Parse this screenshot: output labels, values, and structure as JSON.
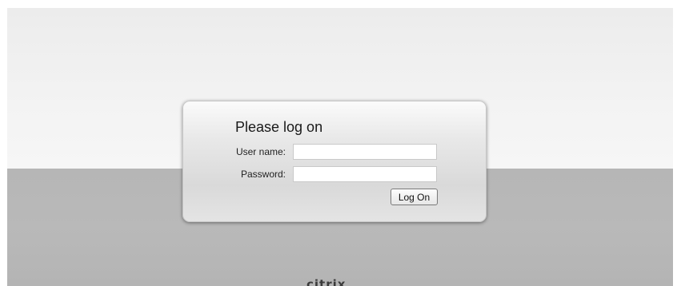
{
  "login": {
    "title": "Please log on",
    "username_label": "User name:",
    "username_value": "",
    "password_label": "Password:",
    "password_value": "",
    "submit_label": "Log On"
  },
  "footer": {
    "logo_text": "citrix"
  },
  "colors": {
    "background_top": "#f3f3f3",
    "background_bottom": "#b7b7b7",
    "panel": "#e3e3e3"
  }
}
